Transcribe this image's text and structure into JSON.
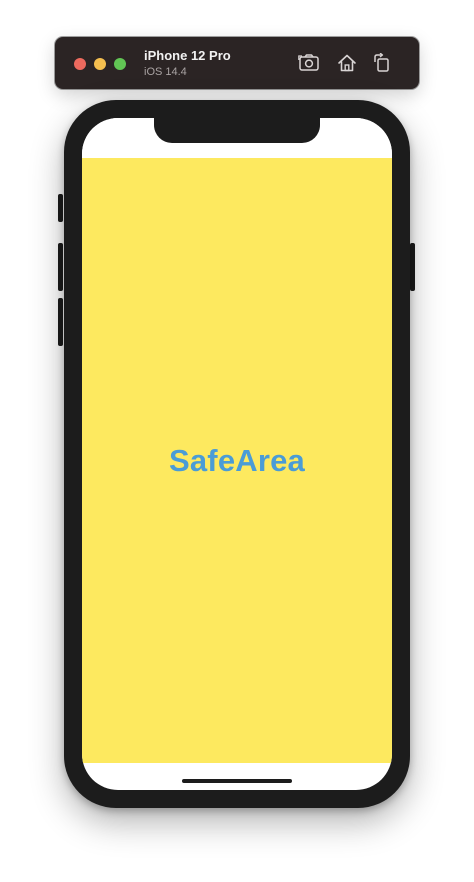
{
  "simulator": {
    "device_name": "iPhone 12 Pro",
    "os_version": "iOS 14.4",
    "toolbar": {
      "screenshot_icon": "camera-icon",
      "home_icon": "home-icon",
      "rotate_icon": "rotate-icon"
    }
  },
  "app": {
    "safe_area_label": "SafeArea",
    "colors": {
      "safe_area_background": "#fde95f",
      "label_color": "#4a9cd6",
      "bezel": "#1c1c1c"
    }
  }
}
